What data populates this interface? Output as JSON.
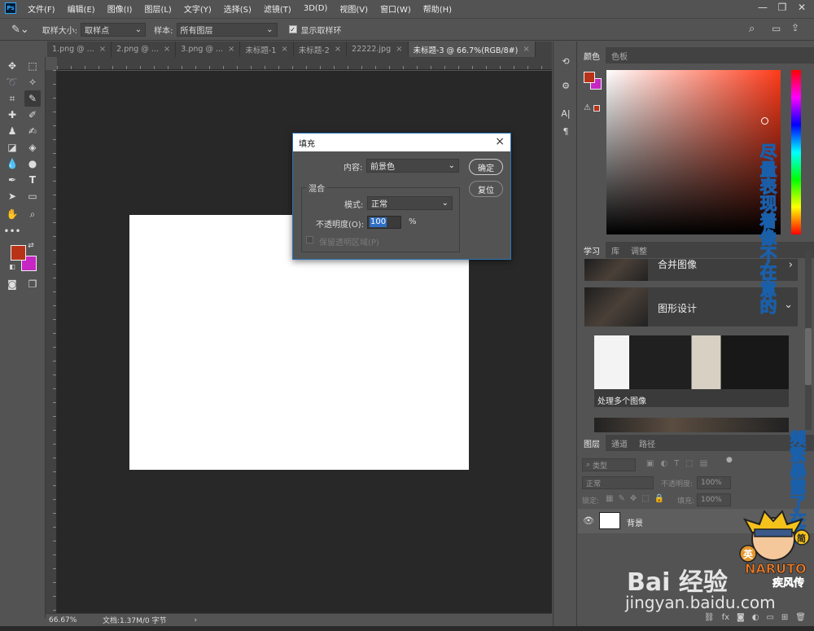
{
  "app": {
    "logo": "Ps"
  },
  "menu": [
    "文件(F)",
    "编辑(E)",
    "图像(I)",
    "图层(L)",
    "文字(Y)",
    "选择(S)",
    "滤镜(T)",
    "3D(D)",
    "视图(V)",
    "窗口(W)",
    "帮助(H)"
  ],
  "window_controls": {
    "minimize": "—",
    "maximize": "❐",
    "close": "✕"
  },
  "options": {
    "sample_size_label": "取样大小:",
    "sample_size_value": "取样点",
    "sample_label": "样本:",
    "sample_value": "所有图层",
    "show_ring_label": "显示取样环",
    "show_ring_checked": true
  },
  "tabs": [
    {
      "label": "1.png @ ...",
      "active": false
    },
    {
      "label": "2.png @ ...",
      "active": false
    },
    {
      "label": "3.png @ ...",
      "active": false
    },
    {
      "label": "未标题-1",
      "active": false
    },
    {
      "label": "未标题-2",
      "active": false
    },
    {
      "label": "22222.jpg",
      "active": false
    },
    {
      "label": "未标题-3 @ 66.7%(RGB/8#)",
      "active": true
    }
  ],
  "colors": {
    "foreground": "#b83218",
    "background": "#c526c4",
    "accent": "#2b73b6"
  },
  "status": {
    "zoom": "66.67%",
    "doc": "文档:1.37M/0 字节"
  },
  "dialog": {
    "title": "填充",
    "content_label": "内容:",
    "content_value": "前景色",
    "blend_group": "混合",
    "mode_label": "模式:",
    "mode_value": "正常",
    "opacity_label": "不透明度(O):",
    "opacity_value": "100",
    "opacity_unit": "%",
    "preserve_label": "保留透明区域(P)",
    "preserve_checked": false,
    "ok": "确定",
    "reset": "复位"
  },
  "color_panel": {
    "tabs": [
      "颜色",
      "色板"
    ]
  },
  "learn_panel": {
    "tabs": [
      "学习",
      "库",
      "调整"
    ],
    "items": [
      {
        "label": "合并图像"
      },
      {
        "label": "图形设计"
      }
    ],
    "card": "处理多个图像"
  },
  "layers_panel": {
    "tabs": [
      "图层",
      "通道",
      "路径"
    ],
    "filter_placeholder": "类型",
    "mode": "正常",
    "opacity_label": "不透明度:",
    "opacity_value": "100%",
    "lock_label": "锁定:",
    "fill_label": "填充:",
    "fill_value": "100%",
    "layers": [
      {
        "name": "背景"
      }
    ]
  },
  "overlay": {
    "caption1": "尽量表现着像不在意的",
    "caption2": "频繁暴露了在乎",
    "watermark": "Bai 经验",
    "watermark_url": "jingyan.baidu.com",
    "badge_top": "简",
    "badge_left": "英",
    "badge_brand": "NARUTO",
    "badge_sub": "疾风传"
  }
}
